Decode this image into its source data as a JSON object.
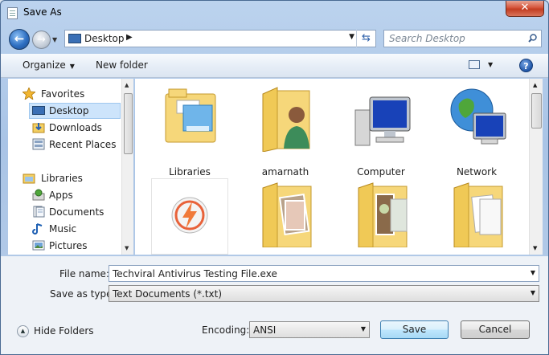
{
  "window": {
    "title": "Save As",
    "close_label": "✕"
  },
  "address": {
    "location": "Desktop",
    "chevron": "▶",
    "search_placeholder": "Search Desktop"
  },
  "toolbar": {
    "organize": "Organize",
    "new_folder": "New folder",
    "help": "?"
  },
  "nav": {
    "items": [
      {
        "label": "Favorites",
        "icon": "star-icon"
      },
      {
        "label": "Desktop",
        "icon": "desktop-icon",
        "selected": true
      },
      {
        "label": "Downloads",
        "icon": "downloads-icon"
      },
      {
        "label": "Recent Places",
        "icon": "recent-places-icon"
      },
      {
        "label": "Libraries",
        "icon": "libraries-icon"
      },
      {
        "label": "Apps",
        "icon": "apps-icon"
      },
      {
        "label": "Documents",
        "icon": "documents-icon"
      },
      {
        "label": "Music",
        "icon": "music-icon"
      },
      {
        "label": "Pictures",
        "icon": "pictures-icon"
      }
    ]
  },
  "files": [
    {
      "label": "Libraries",
      "icon": "libraries-folder-icon"
    },
    {
      "label": "amarnath",
      "icon": "user-folder-icon"
    },
    {
      "label": "Computer",
      "icon": "computer-icon"
    },
    {
      "label": "Network",
      "icon": "network-icon"
    },
    {
      "label": "",
      "icon": "app-shortcut-icon"
    },
    {
      "label": "",
      "icon": "photo-folder-icon"
    },
    {
      "label": "",
      "icon": "photo-folder-icon"
    },
    {
      "label": "",
      "icon": "document-folder-icon"
    }
  ],
  "form": {
    "file_name_label": "File name:",
    "file_name_value": "Techviral Antivirus Testing File.exe",
    "save_type_label": "Save as type:",
    "save_type_value": "Text Documents (*.txt)",
    "encoding_label": "Encoding:",
    "encoding_value": "ANSI",
    "hide_folders": "Hide Folders",
    "save": "Save",
    "cancel": "Cancel"
  }
}
